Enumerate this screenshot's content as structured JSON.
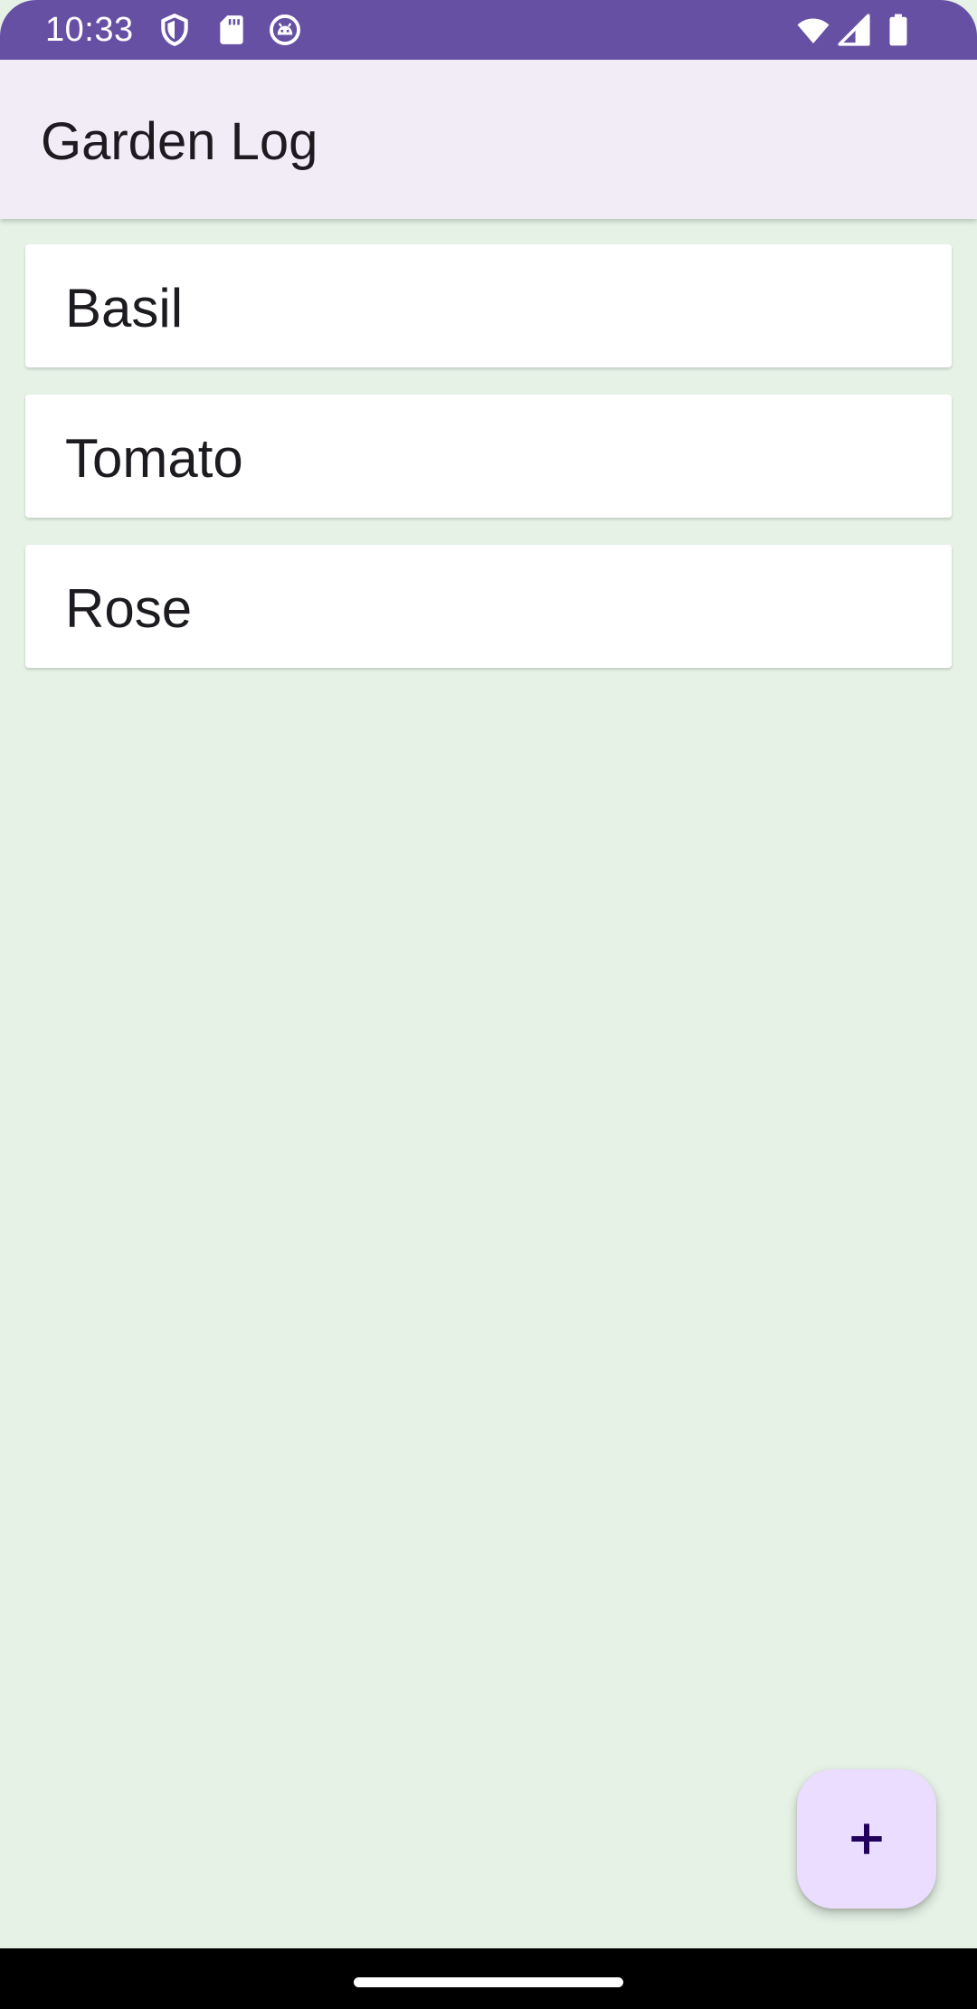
{
  "status_bar": {
    "time": "10:33",
    "background_color": "#6650a4",
    "left_icons": [
      "shield-icon",
      "sd-card-icon",
      "android-head-icon"
    ],
    "right_icons": [
      "wifi-icon",
      "cellular-signal-icon",
      "battery-icon"
    ]
  },
  "app_bar": {
    "title": "Garden Log",
    "background_color": "#f2ecf7"
  },
  "plants": [
    {
      "name": "Basil"
    },
    {
      "name": "Tomato"
    },
    {
      "name": "Rose"
    }
  ],
  "fab": {
    "icon": "plus-icon",
    "background_color": "#eaddff",
    "icon_color": "#21005d"
  },
  "content_background_color": "#e6f2e6",
  "navigation_bar": {
    "handle": "home-gesture-handle"
  }
}
